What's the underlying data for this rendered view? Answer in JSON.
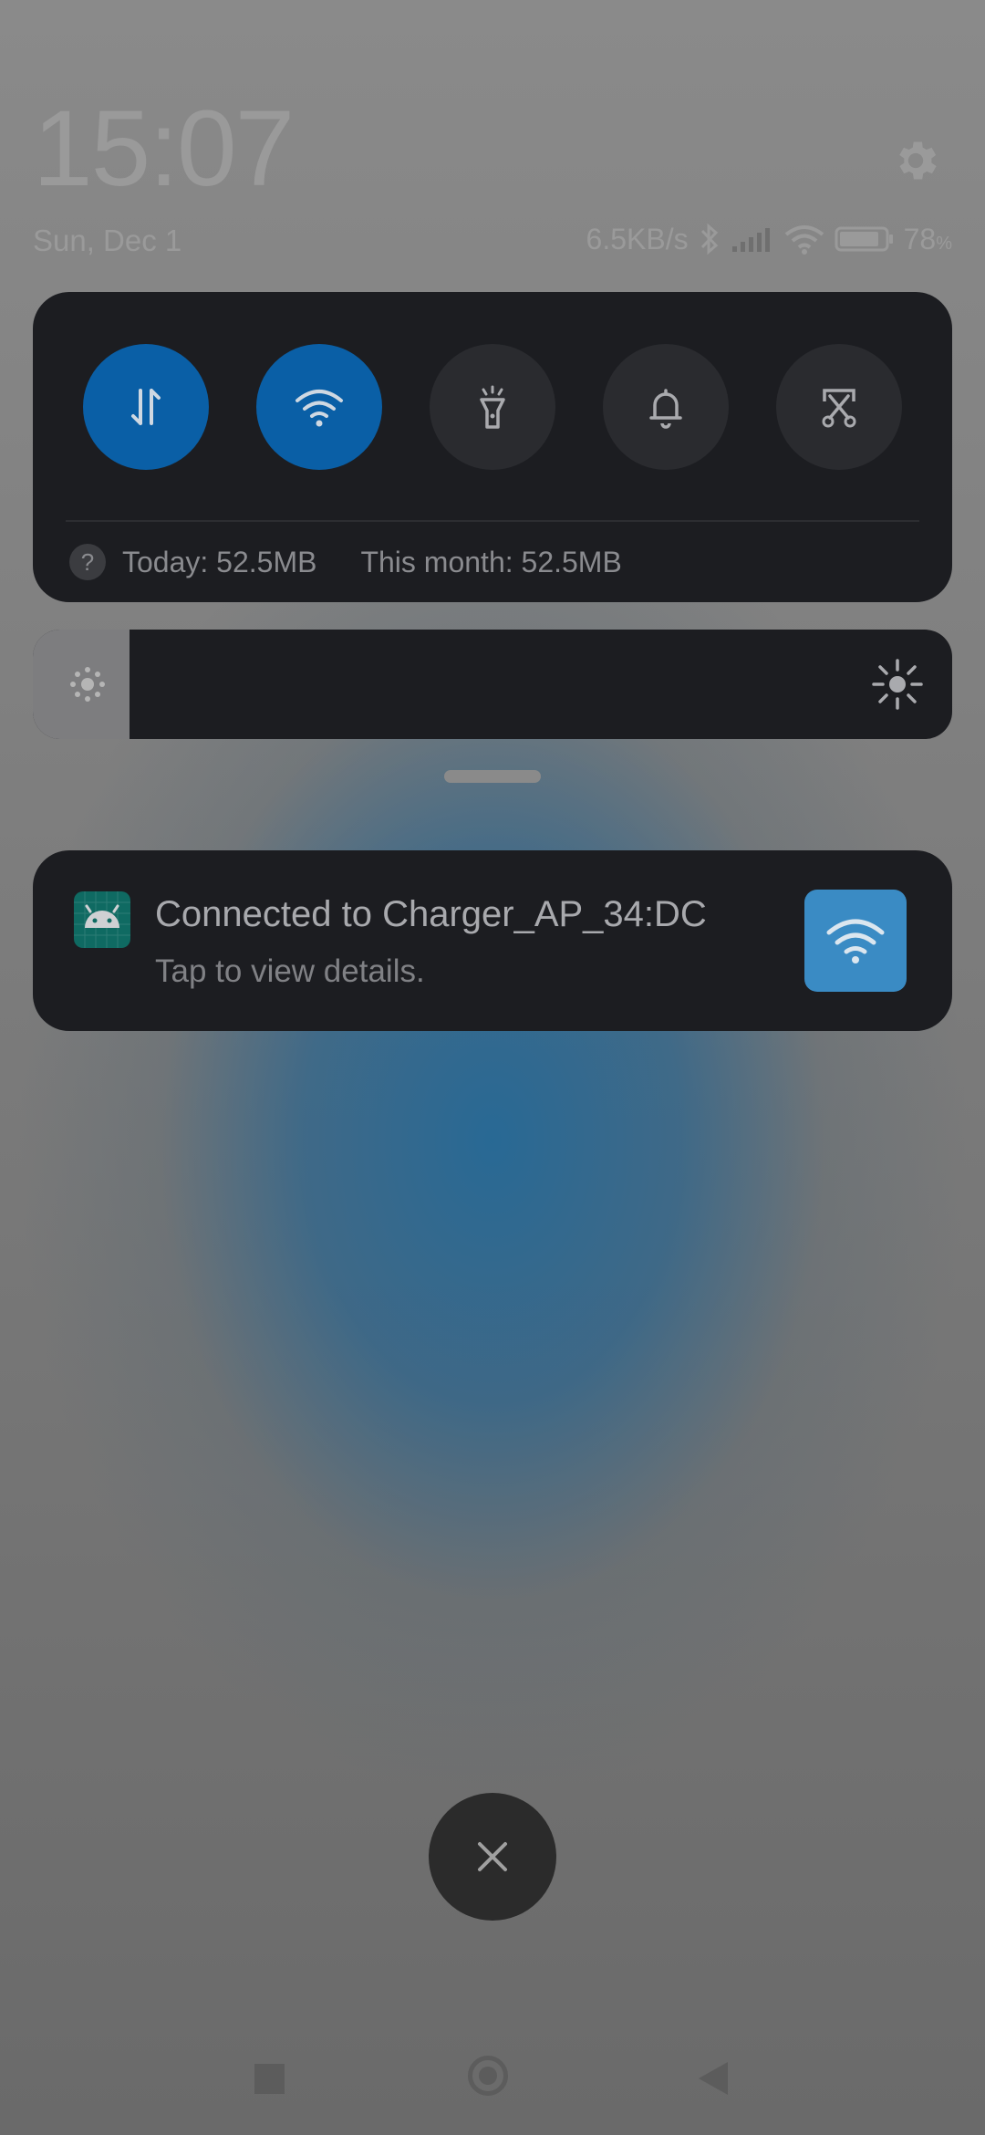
{
  "lockscreen": {
    "time": "15:07",
    "date": "Sun, Dec 1"
  },
  "status_bar": {
    "net_speed": "6.5KB/s",
    "battery_value": "78",
    "battery_unit": "%"
  },
  "quick_settings": {
    "tiles": [
      {
        "name": "mobile-data",
        "icon": "data-arrows-icon",
        "active": true
      },
      {
        "name": "wifi",
        "icon": "wifi-icon",
        "active": true
      },
      {
        "name": "flashlight",
        "icon": "flashlight-icon",
        "active": false
      },
      {
        "name": "sound",
        "icon": "bell-icon",
        "active": false
      },
      {
        "name": "screenshot",
        "icon": "scissors-screenshot-icon",
        "active": false
      }
    ],
    "usage_today": "Today: 52.5MB",
    "usage_month": "This month: 52.5MB",
    "help_icon": "?"
  },
  "brightness": {
    "level": 0.105
  },
  "notification": {
    "title": "Connected to Charger_AP_34:DC",
    "subtitle": "Tap to view details.",
    "app_icon": "android-icon",
    "action_icon": "wifi-icon"
  },
  "colors": {
    "tile_active": "#0a5fa6",
    "panel_bg": "#1c1d21",
    "wifi_action_bg": "#3a8bc4"
  },
  "close_icon": "close-icon"
}
